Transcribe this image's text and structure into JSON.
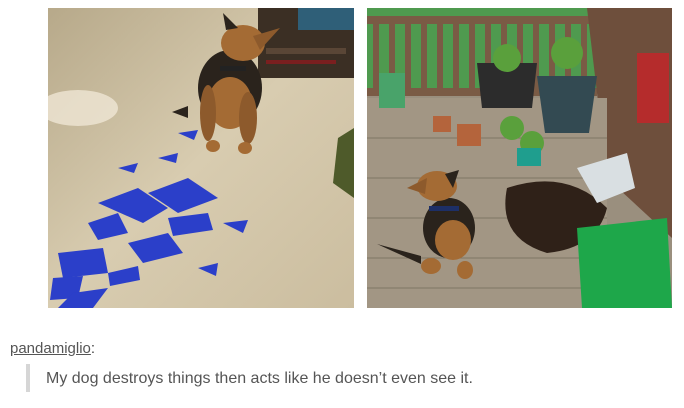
{
  "post": {
    "photos": [
      {
        "subject": "dog sitting by torn blue debris on carpet"
      },
      {
        "subject": "dog sitting on deck by knocked over potting soil and bin"
      }
    ],
    "reply": {
      "author": "pandamiglio",
      "separator": ":",
      "text": "My dog destroys things then acts like he doesn’t even see it."
    },
    "colors": {
      "link": "#555555",
      "quote_bar": "#d6d6d6",
      "text": "#555555"
    }
  }
}
